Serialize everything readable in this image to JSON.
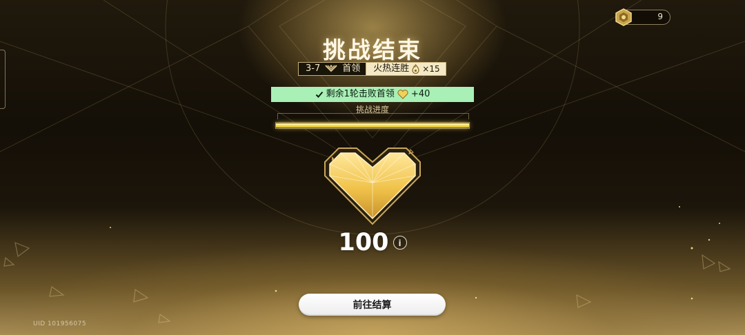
{
  "header": {
    "title": "挑战结束",
    "stage": "3-7",
    "boss_label": "首领",
    "streak_label": "火热连胜",
    "streak_multiplier": "×15"
  },
  "currency": {
    "value": "9",
    "icon": "medal-coin-icon"
  },
  "objective": {
    "text": "剩余1轮击败首领",
    "reward": "+40",
    "check_icon": "check-icon",
    "reward_icon": "heart-icon"
  },
  "progress": {
    "label": "挑战进度",
    "fraction": 1.0
  },
  "result": {
    "score": "100",
    "info_icon": "info-icon"
  },
  "actions": {
    "settle_label": "前往结算"
  },
  "footer": {
    "uid": "UID 101956075"
  },
  "colors": {
    "gold": "#f2d84a",
    "objective_bg": "#a8f0b6",
    "title_text": "#fff8e6"
  }
}
